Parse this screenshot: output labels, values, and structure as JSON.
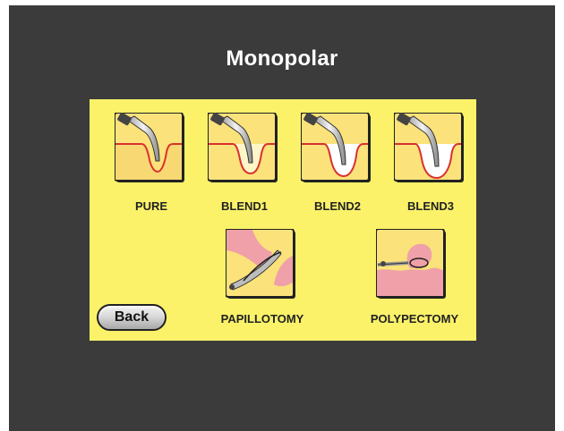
{
  "screen": {
    "title": "Monopolar",
    "background": "#3b3b3b",
    "panel_color": "#fbf26a"
  },
  "modes": [
    {
      "label": "PURE",
      "icon": "electrode-pure-icon"
    },
    {
      "label": "BLEND1",
      "icon": "electrode-blend1-icon"
    },
    {
      "label": "BLEND2",
      "icon": "electrode-blend2-icon"
    },
    {
      "label": "BLEND3",
      "icon": "electrode-blend3-icon"
    },
    {
      "label": "PAPILLOTOMY",
      "icon": "papillotomy-icon"
    },
    {
      "label": "POLYPECTOMY",
      "icon": "polypectomy-icon"
    }
  ],
  "back_button": {
    "label": "Back"
  }
}
